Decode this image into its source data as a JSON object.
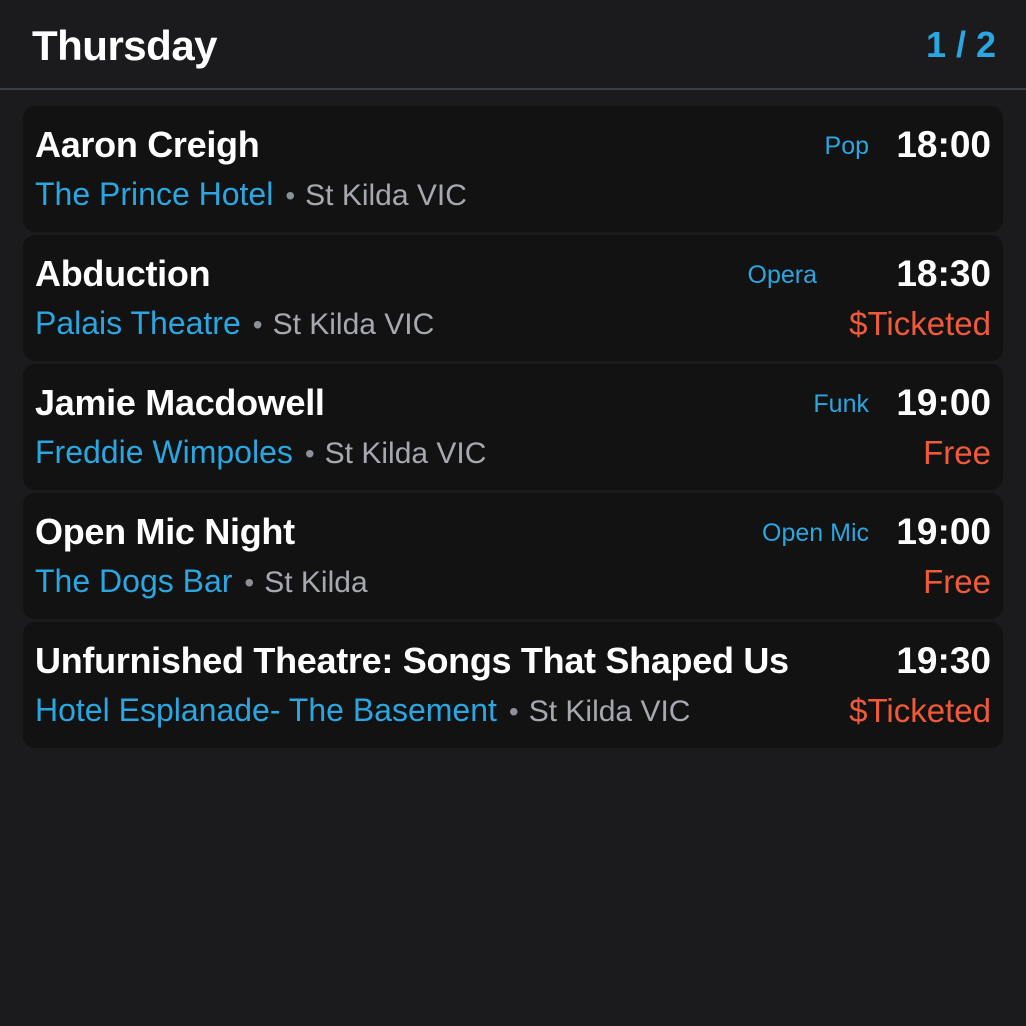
{
  "header": {
    "day": "Thursday",
    "page_indicator": "1 / 2"
  },
  "colors": {
    "background": "#1b1b1d",
    "card": "#121213",
    "accent_blue": "#2aa6e0",
    "price_orange": "#f05a3a",
    "text_white": "#ffffff",
    "text_grey": "#a7a9b0"
  },
  "events": [
    {
      "title": "Aaron Creigh",
      "genre": "Pop",
      "time": "18:00",
      "venue": "The Prince Hotel",
      "locality": "St Kilda VIC",
      "price": ""
    },
    {
      "title": "Abduction",
      "genre": "Opera",
      "time": "18:30",
      "venue": "Palais Theatre",
      "locality": "St Kilda VIC",
      "price": "$Ticketed"
    },
    {
      "title": "Jamie Macdowell",
      "genre": "Funk",
      "time": "19:00",
      "venue": "Freddie Wimpoles",
      "locality": "St Kilda VIC",
      "price": "Free"
    },
    {
      "title": "Open Mic Night",
      "genre": "Open Mic",
      "time": "19:00",
      "venue": "The Dogs Bar",
      "locality": "St Kilda",
      "price": "Free"
    },
    {
      "title": "Unfurnished Theatre: Songs That Shaped Us",
      "genre": "",
      "time": "19:30",
      "venue": "Hotel Esplanade- The Basement",
      "locality": "St Kilda VIC",
      "price": "$Ticketed"
    }
  ]
}
